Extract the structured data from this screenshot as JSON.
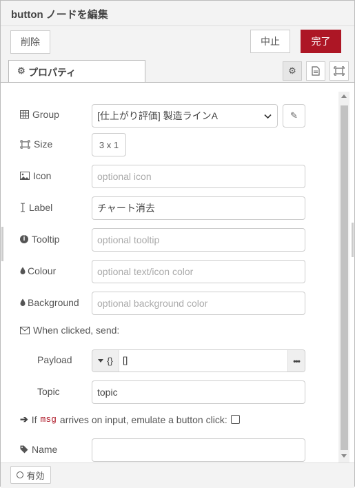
{
  "dialog": {
    "title": "button ノードを編集"
  },
  "toolbar": {
    "delete_label": "削除",
    "cancel_label": "中止",
    "done_label": "完了"
  },
  "tabs": {
    "properties_label": "プロパティ"
  },
  "form": {
    "group": {
      "label": "Group",
      "value": "[仕上がり評価] 製造ラインA"
    },
    "size": {
      "label": "Size",
      "value": "3 x 1"
    },
    "icon": {
      "label": "Icon",
      "placeholder": "optional icon"
    },
    "label": {
      "label": "Label",
      "value": "チャート消去"
    },
    "tooltip": {
      "label": "Tooltip",
      "placeholder": "optional tooltip"
    },
    "colour": {
      "label": "Colour",
      "placeholder": "optional text/icon color"
    },
    "background": {
      "label": "Background",
      "placeholder": "optional background color"
    },
    "when_clicked": {
      "label": "When clicked, send:"
    },
    "payload": {
      "label": "Payload",
      "type_icon": "{}",
      "value": "[]"
    },
    "topic": {
      "label": "Topic",
      "value": "topic"
    },
    "emulate": {
      "prefix": "If",
      "code": "msg",
      "suffix": "arrives on input, emulate a button click:",
      "checked": false
    },
    "name": {
      "label": "Name",
      "value": ""
    }
  },
  "footer": {
    "enabled_label": "有効"
  },
  "colors": {
    "accent": "#ad1625",
    "code": "#ad1625"
  }
}
